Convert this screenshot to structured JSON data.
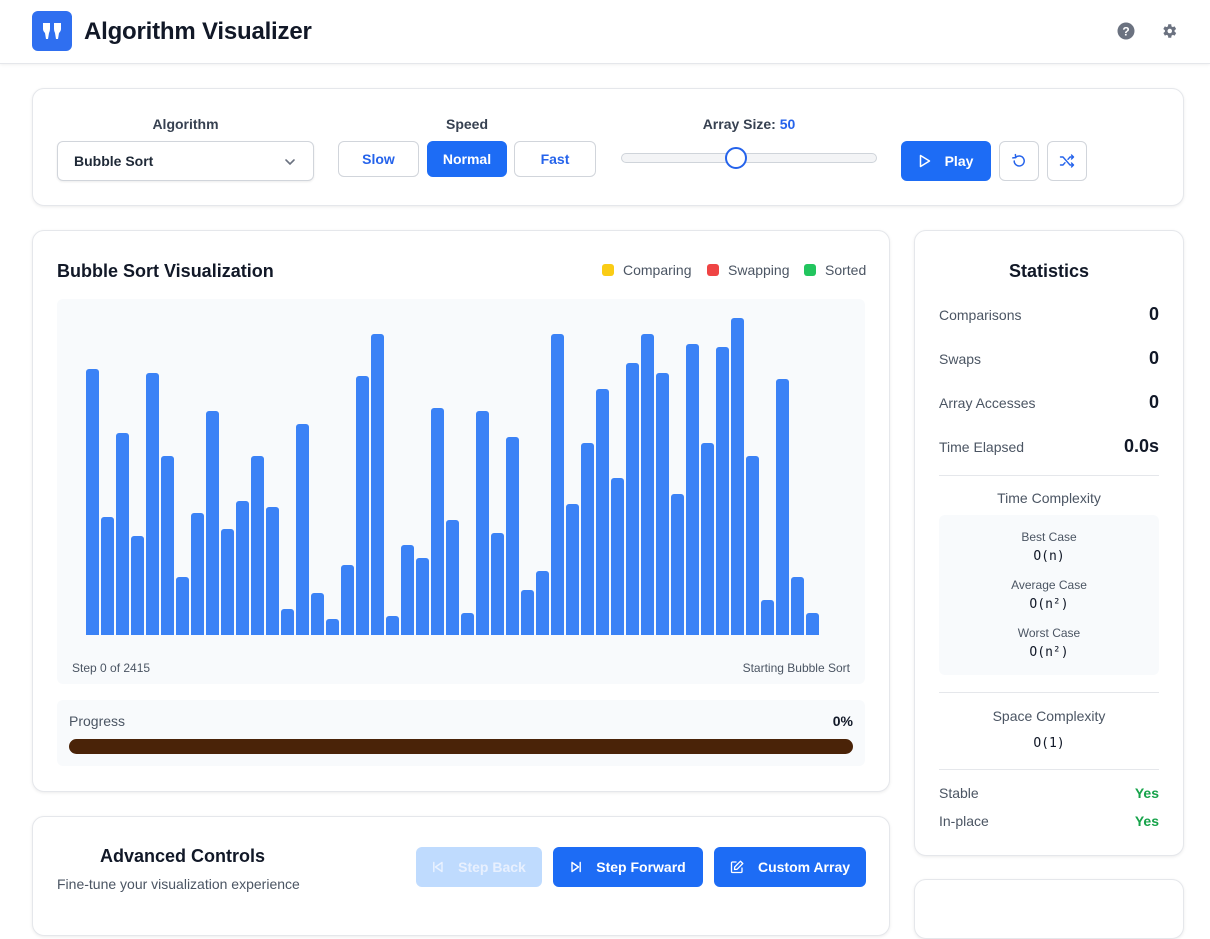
{
  "app": {
    "title": "Algorithm Visualizer"
  },
  "controls": {
    "algorithm_label": "Algorithm",
    "algorithm_selected": "Bubble Sort",
    "speed_label": "Speed",
    "speed_options": [
      "Slow",
      "Normal",
      "Fast"
    ],
    "speed_selected": "Normal",
    "array_size_label": "Array Size:",
    "array_size_value": "50",
    "array_size_fraction": 0.45,
    "play_label": "Play"
  },
  "visualization": {
    "title": "Bubble Sort Visualization",
    "legend": [
      {
        "label": "Comparing",
        "color": "#facc15"
      },
      {
        "label": "Swapping",
        "color": "#ef4444"
      },
      {
        "label": "Sorted",
        "color": "#22c55e"
      }
    ],
    "bar_color": "#3b82f6",
    "bar_values": [
      83,
      37,
      63,
      31,
      82,
      56,
      18,
      38,
      70,
      33,
      42,
      56,
      40,
      8,
      66,
      13,
      5,
      22,
      81,
      94,
      6,
      28,
      24,
      71,
      36,
      7,
      70,
      32,
      62,
      14,
      20,
      94,
      41,
      60,
      77,
      49,
      85,
      94,
      82,
      44,
      91,
      60,
      90,
      99,
      56,
      11,
      80,
      18,
      7
    ],
    "step_text": "Step 0 of 2415",
    "status_text": "Starting Bubble Sort",
    "progress_label": "Progress",
    "progress_text": "0%",
    "progress_value": 0
  },
  "statistics": {
    "title": "Statistics",
    "rows": [
      {
        "label": "Comparisons",
        "value": "0"
      },
      {
        "label": "Swaps",
        "value": "0"
      },
      {
        "label": "Array Accesses",
        "value": "0"
      },
      {
        "label": "Time Elapsed",
        "value": "0.0s"
      }
    ],
    "time_complexity_title": "Time Complexity",
    "best_label": "Best Case",
    "best_value": "O(n)",
    "average_label": "Average Case",
    "average_value": "O(n²)",
    "worst_label": "Worst Case",
    "worst_value": "O(n²)",
    "space_complexity_title": "Space Complexity",
    "space_value": "O(1)",
    "stable_label": "Stable",
    "stable_value": "Yes",
    "inplace_label": "In-place",
    "inplace_value": "Yes"
  },
  "advanced": {
    "title": "Advanced Controls",
    "subtitle": "Fine-tune your visualization experience",
    "step_back_label": "Step Back",
    "step_forward_label": "Step Forward",
    "custom_array_label": "Custom Array"
  },
  "colors": {
    "accent": "#1d6cf5",
    "success": "#16a34a",
    "progress_track": "#4a2308"
  }
}
